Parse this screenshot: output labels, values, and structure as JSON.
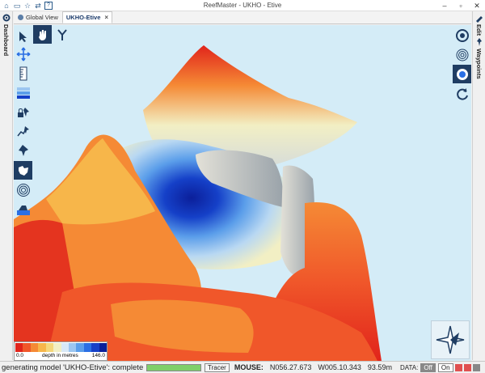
{
  "window": {
    "title": "ReefMaster - UKHO - Etive",
    "minimize": "–",
    "maximize": "▫",
    "close": "✕"
  },
  "quick_access": {
    "icons": [
      "home-icon",
      "folder-icon",
      "star-icon",
      "sync-icon",
      "help-icon"
    ]
  },
  "tabs": [
    {
      "label": "Global View",
      "active": false,
      "icon": "globe-icon"
    },
    {
      "label": "UKHO-Etive",
      "active": true,
      "close": "×"
    }
  ],
  "left_panel": {
    "label": "Dashboard"
  },
  "right_panel": {
    "labels": [
      "Edit",
      "Waypoints"
    ]
  },
  "legend": {
    "min_label": "0.0",
    "center_label": "depth in metres",
    "max_label": "146.0",
    "colors": [
      "#e1241b",
      "#f0572a",
      "#f58a35",
      "#f7b64a",
      "#f5d77a",
      "#f2efc4",
      "#d8e9f7",
      "#9cc6f0",
      "#5b9eea",
      "#2a6fe4",
      "#1540c8",
      "#0b1f9a"
    ]
  },
  "status": {
    "message": "generating model 'UKHO-Etive': complete",
    "progress": 1.0,
    "tracer_label": "Tracer",
    "mouse_label": "MOUSE:",
    "lat": "N056.27.673",
    "lon": "W005.10.343",
    "depth": "93.59m",
    "data_label": "DATA:",
    "off_label": "Off",
    "on_label": "On"
  },
  "colors": {
    "selected_tool": "#1f3d63",
    "viewport_bg": "#d4ecf7",
    "accent": "#2a5a8a"
  }
}
